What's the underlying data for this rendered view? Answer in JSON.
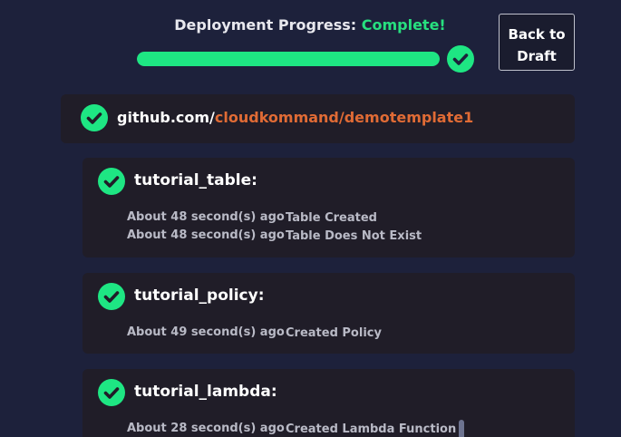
{
  "progress": {
    "title": "Deployment Progress:",
    "status": "Complete!",
    "percent": 100,
    "check_icon": "check-circle-icon",
    "accent_color": "#1ee683"
  },
  "actions": {
    "back_line1": "Back to",
    "back_line2": "Draft"
  },
  "repo": {
    "host": "github.com/",
    "path": "cloudkommand/demotemplate1",
    "path_color": "#e06b35"
  },
  "resources": [
    {
      "name": "tutorial_table:",
      "events": [
        {
          "time": "About 48 second(s) ago",
          "message": "Table Created"
        },
        {
          "time": "About 48 second(s) ago",
          "message": "Table Does Not Exist"
        }
      ]
    },
    {
      "name": "tutorial_policy:",
      "events": [
        {
          "time": "About 49 second(s) ago",
          "message": "Created Policy"
        }
      ]
    },
    {
      "name": "tutorial_lambda:",
      "events": [
        {
          "time": "About 28 second(s) ago",
          "message": "Created Lambda Function"
        }
      ]
    }
  ]
}
